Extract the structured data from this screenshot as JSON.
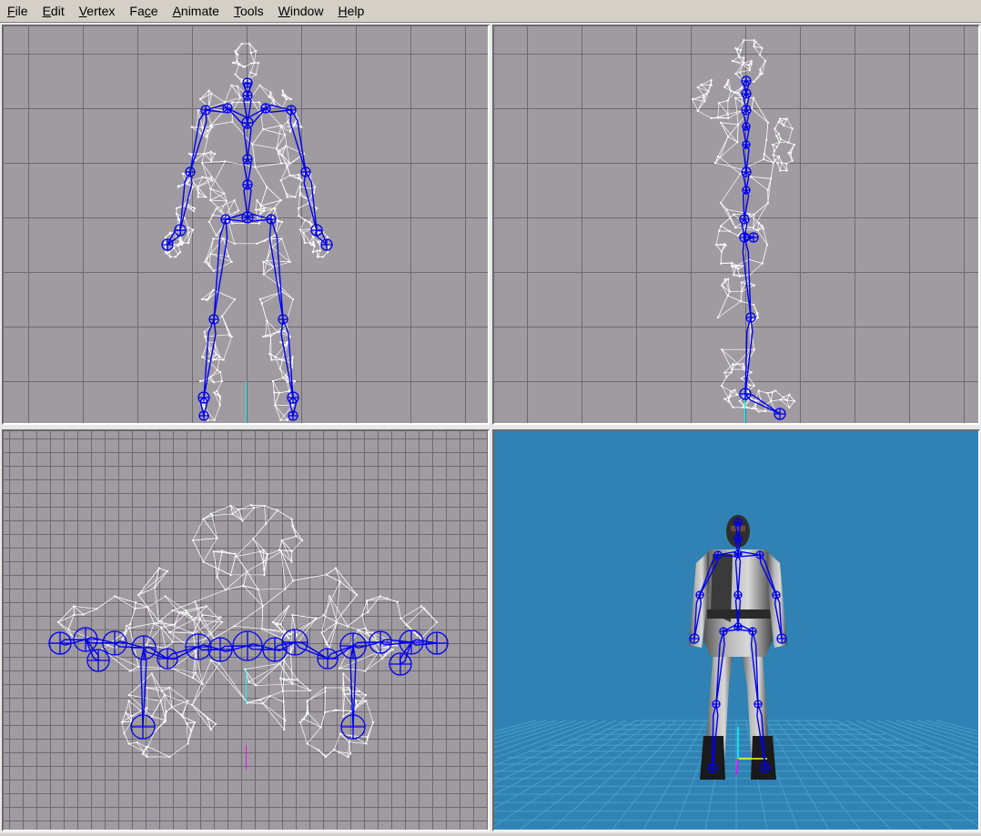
{
  "menu": [
    {
      "id": "file",
      "underline": "F",
      "rest": "ile"
    },
    {
      "id": "edit",
      "underline": "E",
      "rest": "dit"
    },
    {
      "id": "vertex",
      "underline": "V",
      "rest": "ertex"
    },
    {
      "id": "face",
      "pre": "Fa",
      "underline": "c",
      "rest": "e"
    },
    {
      "id": "animate",
      "underline": "A",
      "rest": "nimate"
    },
    {
      "id": "tools",
      "underline": "T",
      "rest": "ools"
    },
    {
      "id": "window",
      "underline": "W",
      "rest": "indow"
    },
    {
      "id": "help",
      "underline": "H",
      "rest": "elp"
    }
  ],
  "colors": {
    "ortho_background": "#a09ba1",
    "grid_line": "#6e6a72",
    "wireframe": "#ffffff",
    "skeleton": "#0000ee",
    "perspective_background": "#2f82b3",
    "perspective_grid": "#4aa0c8",
    "origin_axis_cyan": "#00ffff",
    "origin_axis_magenta": "#ff00ff",
    "origin_axis_yellow": "#ffff00"
  },
  "viewports": [
    {
      "id": "front",
      "kind": "orthographic"
    },
    {
      "id": "side",
      "kind": "orthographic"
    },
    {
      "id": "top",
      "kind": "orthographic"
    },
    {
      "id": "perspective",
      "kind": "3d-render"
    }
  ]
}
